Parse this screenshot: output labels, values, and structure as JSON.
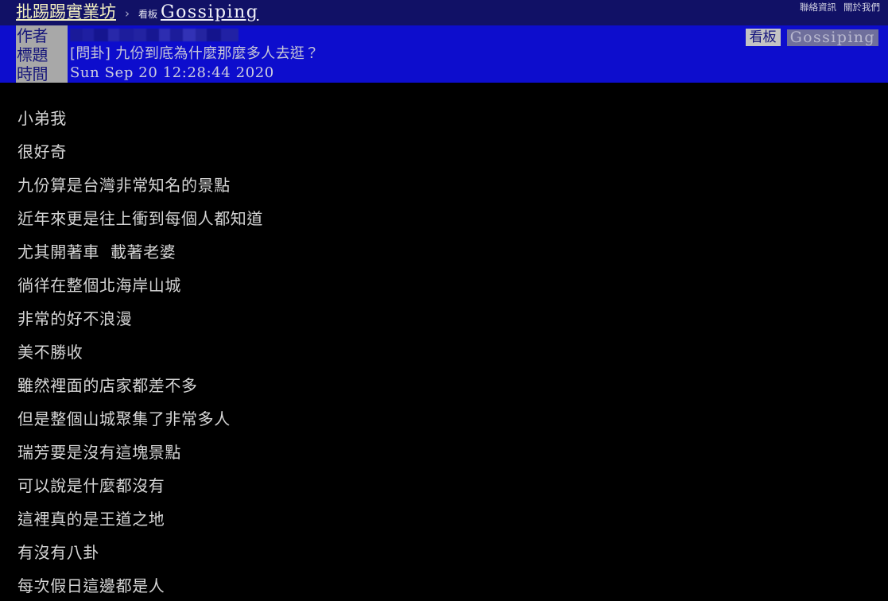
{
  "top_nav": {
    "site_title": "批踢踢實業坊",
    "separator": "›",
    "board_label": "看板",
    "board_name": "Gossiping",
    "links": [
      {
        "label": "聯絡資訊"
      },
      {
        "label": "關於我們"
      }
    ]
  },
  "article_meta": {
    "labels": {
      "author": "作者",
      "title": "標題",
      "time": "時間"
    },
    "values": {
      "author": "",
      "author_state": "redacted",
      "title": "[問卦] 九份到底為什麼那麼多人去逛？",
      "time": "Sun Sep 20 12:28:44 2020"
    },
    "badge": {
      "label": "看板",
      "board": "Gossiping"
    }
  },
  "article_body": {
    "lines": [
      "小弟我",
      "很好奇",
      "九份算是台灣非常知名的景點",
      "近年來更是往上衝到每個人都知道",
      "尤其開著車  載著老婆",
      "徜徉在整個北海岸山城",
      "非常的好不浪漫",
      "美不勝收",
      "雖然裡面的店家都差不多",
      "但是整個山城聚集了非常多人",
      "瑞芳要是沒有這塊景點",
      "可以說是什麼都沒有",
      "這裡真的是王道之地",
      "有沒有八卦",
      "每次假日這邊都是人"
    ]
  },
  "colors": {
    "nav_background": "#111166",
    "meta_background": "#0d0dcd",
    "page_background": "#000000",
    "site_title": "#f3f0c0",
    "body_text": "#d6d6d6",
    "label_background": "#a8a8a8",
    "label_text": "#16167a"
  }
}
